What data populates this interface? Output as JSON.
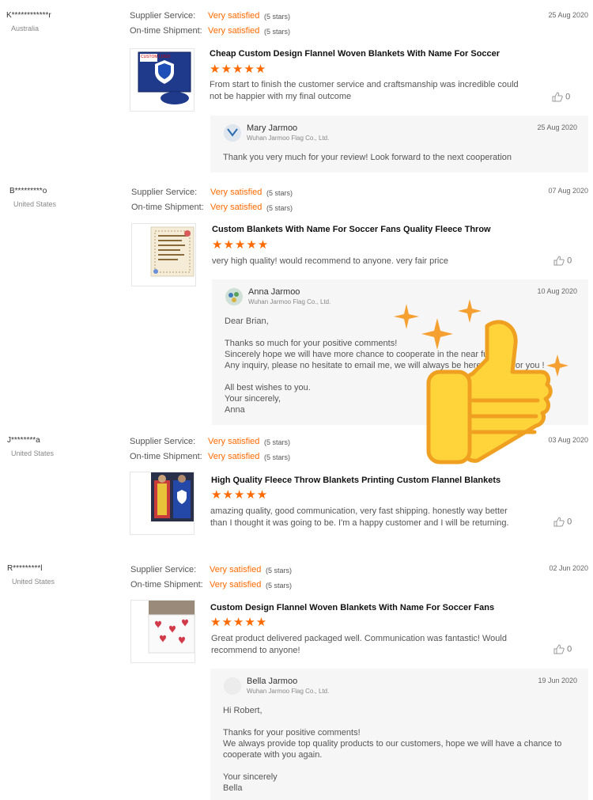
{
  "labels": {
    "supplier_service": "Supplier Service:",
    "ontime_shipment": "On-time Shipment:",
    "very_satisfied": "Very satisfied",
    "five_stars": "(5 stars)",
    "stars": "★★★★★"
  },
  "colors": {
    "accent": "#ff6a00",
    "reply_bg": "#f6f6f6"
  },
  "reviews": [
    {
      "buyer": "K************r",
      "country": "Australia",
      "date": "25 Aug 2020",
      "product": "Cheap Custom Design Flannel Woven Blankets With Name For Soccer",
      "text": "From start to finish the customer service and craftsmanship was incredible could not be happier with my final outcome",
      "likes": "0",
      "thumb_label": "CUSTOM LOGO",
      "reply": {
        "name": "Mary Jarmoo",
        "company": "Wuhan Jarmoo Flag Co., Ltd.",
        "date": "25 Aug 2020",
        "text": "Thank you very much for your review! Look forward to the next cooperation"
      }
    },
    {
      "buyer": "B*********o",
      "country": "United States",
      "date": "07 Aug 2020",
      "product": "Custom Blankets With Name For Soccer Fans Quality Fleece Throw",
      "text": "very high quality! would recommend to anyone. very fair price",
      "likes": "0",
      "reply": {
        "name": "Anna Jarmoo",
        "company": "Wuhan Jarmoo Flag Co., Ltd.",
        "date": "10 Aug 2020",
        "text": "Dear Brian,\n\nThanks so much for your positive comments!\nSincerely hope we will have more chance to cooperate in the near future.\nAny inquiry, please no hesitate to email me, we will always be here waiting for you !\n\nAll best wishes to you.\nYour sincerely,\nAnna"
      }
    },
    {
      "buyer": "J********a",
      "country": "United States",
      "date": "03 Aug 2020",
      "product": "High Quality Fleece Throw Blankets Printing Custom Flannel Blankets",
      "text": "amazing quality, good communication, very fast shipping. honestly way better than I thought it was going to be. I'm a happy customer and I will be returning.",
      "likes": "0"
    },
    {
      "buyer": "R*********l",
      "country": "United States",
      "date": "02 Jun 2020",
      "product": "Custom Design Flannel Woven Blankets With Name For Soccer Fans",
      "text": "Great product delivered packaged well. Communication was fantastic! Would recommend to anyone!",
      "likes": "0",
      "reply": {
        "name": "Bella Jarmoo",
        "company": "Wuhan Jarmoo Flag Co., Ltd.",
        "date": "19 Jun 2020",
        "text": "Hi Robert,\n\nThanks for your positive comments!\nWe always provide top quality products to our customers, hope we will have a chance to cooperate with you again.\n\nYour sincerely\nBella"
      }
    }
  ]
}
